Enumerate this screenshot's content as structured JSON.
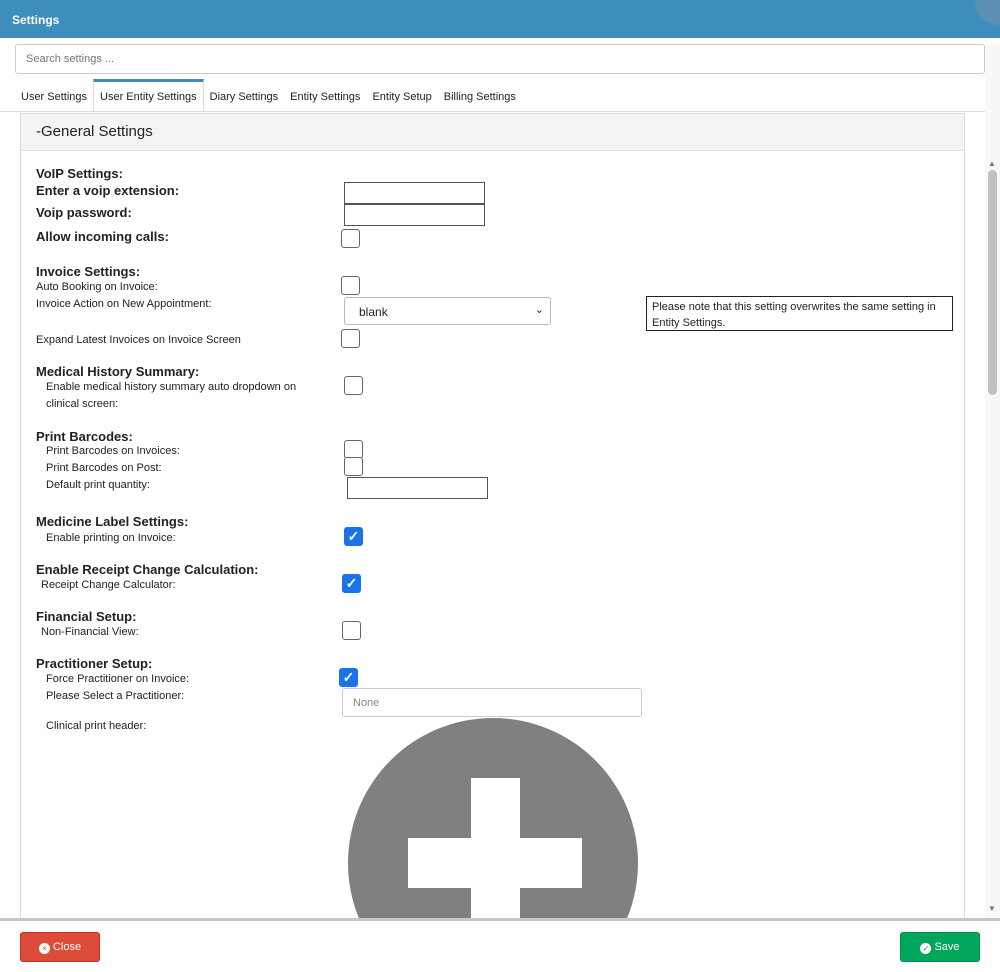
{
  "header": {
    "title": "Settings"
  },
  "search": {
    "placeholder": "Search settings ..."
  },
  "tabs": [
    "User Settings",
    "User Entity Settings",
    "Diary Settings",
    "Entity Settings",
    "Entity Setup",
    "Billing Settings"
  ],
  "panel": {
    "title": "General Settings",
    "collapse": "-"
  },
  "voip": {
    "heading": "VoIP Settings:",
    "extension": "Enter a voip extension:",
    "password": "Voip password:",
    "incoming": "Allow incoming calls:"
  },
  "invoice": {
    "heading": "Invoice Settings:",
    "auto_booking": "Auto Booking on Invoice:",
    "action": "Invoice Action on New Appointment:",
    "action_value": "blank",
    "expand": "Expand Latest Invoices on Invoice Screen",
    "note": "Please note that this setting overwrites the same setting in Entity Settings."
  },
  "medical": {
    "heading": "Medical History Summary:",
    "line1": "Enable medical history summary auto dropdown on",
    "line2": "clinical screen:"
  },
  "barcodes": {
    "heading": "Print Barcodes:",
    "invoices": "Print Barcodes on Invoices:",
    "post": "Print Barcodes on Post:",
    "quantity": "Default print quantity:"
  },
  "medicine": {
    "heading": "Medicine Label Settings:",
    "enable": "Enable printing on Invoice:",
    "checked": true
  },
  "receipt": {
    "heading": "Enable Receipt Change Calculation:",
    "calc": "Receipt Change Calculator:",
    "checked": true
  },
  "financial": {
    "heading": "Financial Setup:",
    "nonfin": "Non-Financial View:",
    "checked": false
  },
  "practitioner": {
    "heading": "Practitioner Setup:",
    "force": "Force Practitioner on Invoice:",
    "force_checked": true,
    "select": "Please Select a Practitioner:",
    "select_placeholder": "None",
    "header": "Clinical print header:"
  },
  "footer": {
    "close": "Close",
    "save": "Save",
    "close_icon": "×",
    "save_icon": "✓"
  },
  "check_glyph": "✓"
}
